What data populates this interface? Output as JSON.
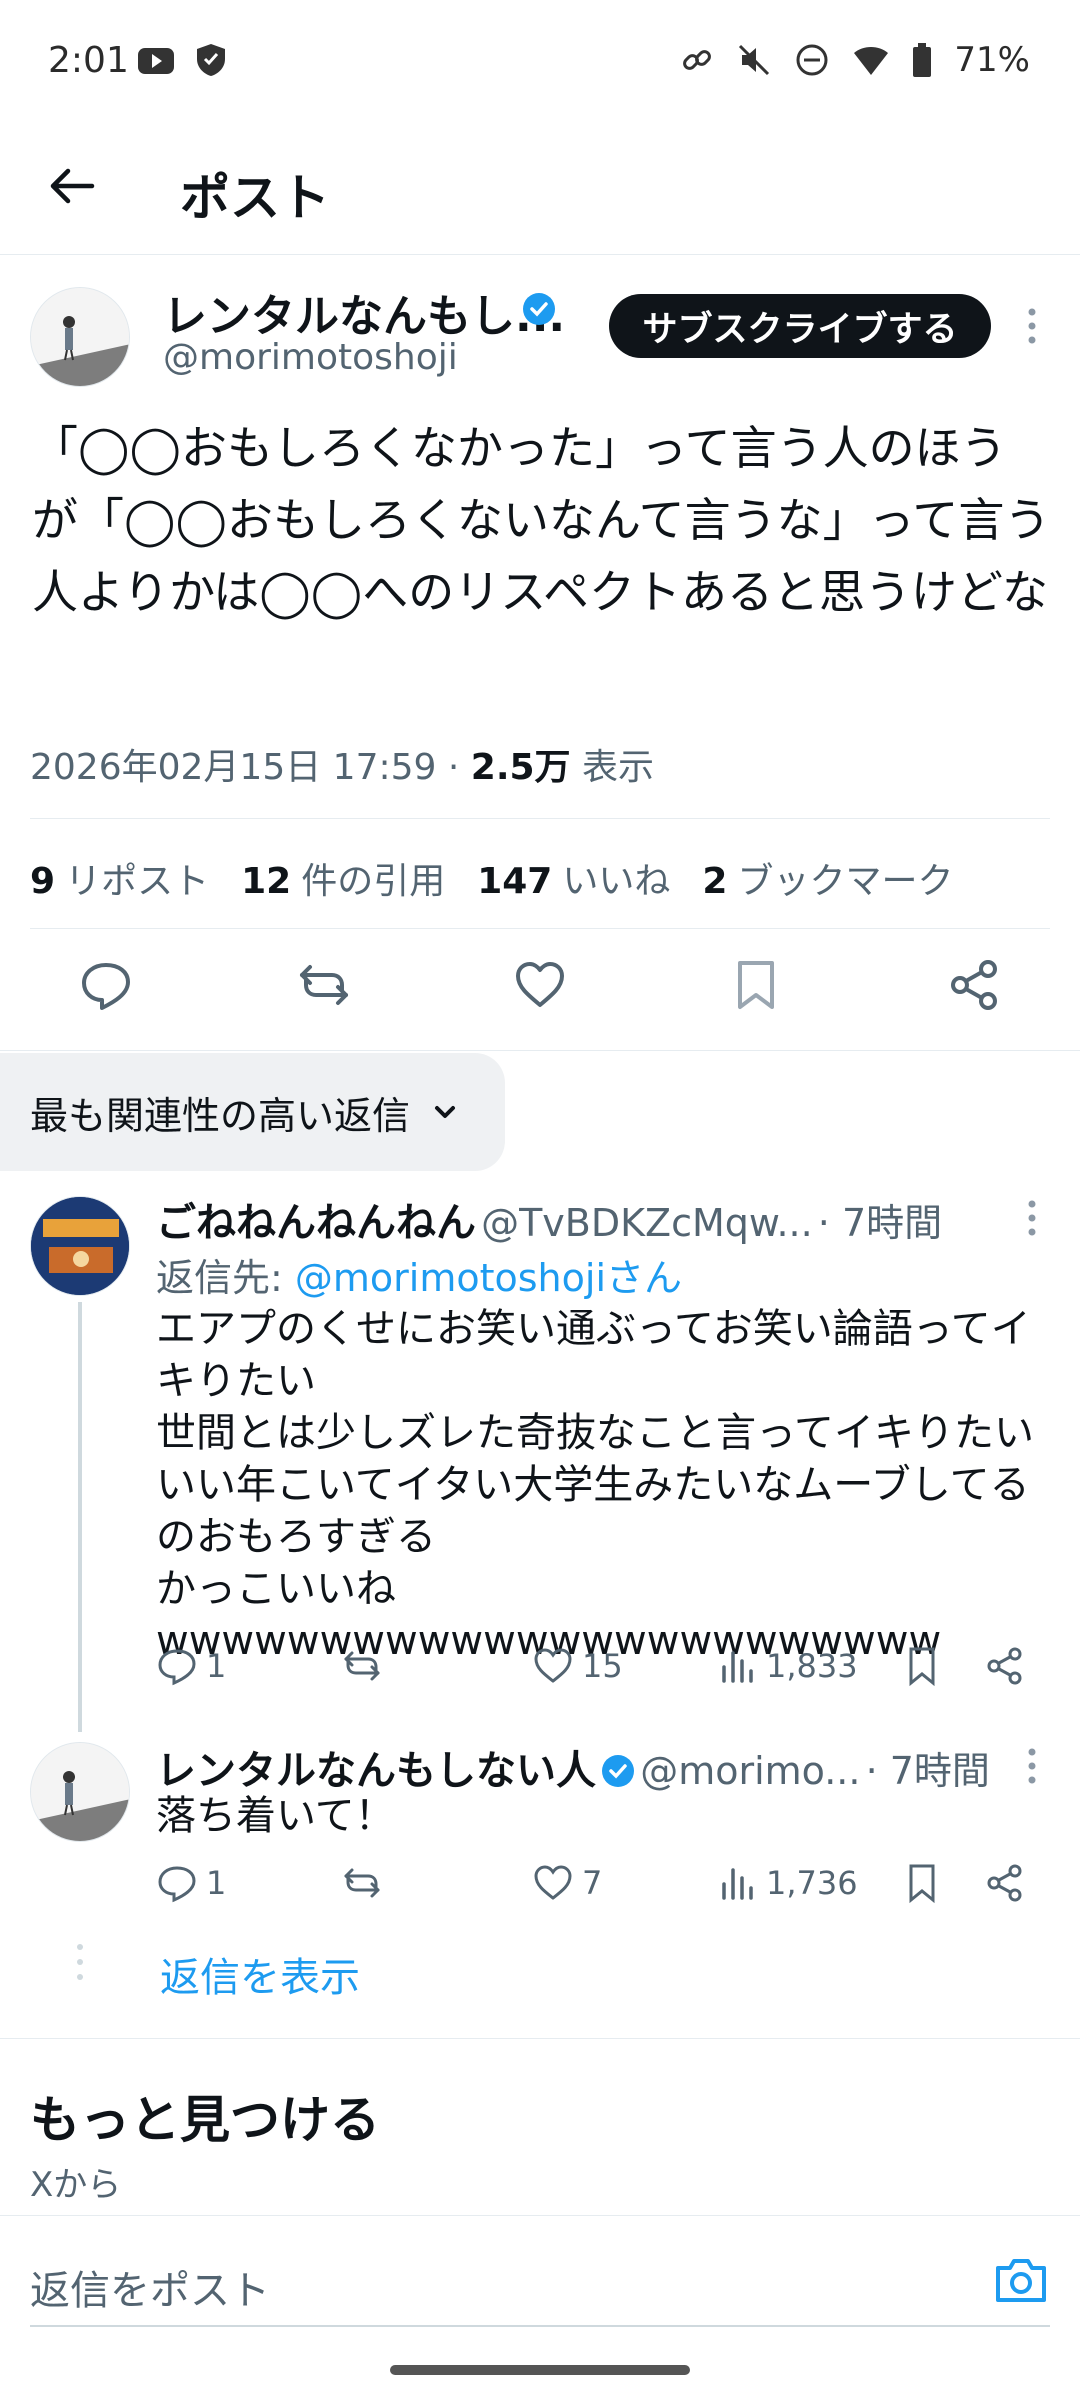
{
  "status_bar": {
    "time": "2:01",
    "battery": "71%",
    "icons_left": [
      "youtube-icon",
      "shield-icon"
    ],
    "icons_right": [
      "link-icon",
      "mute-icon",
      "dnd-icon",
      "wifi-icon",
      "battery-icon"
    ]
  },
  "header": {
    "title": "ポスト"
  },
  "main_post": {
    "author_name": "レンタルなんもし...",
    "handle": "@morimotoshoji",
    "subscribe_label": "サブスクライブする",
    "text": "「◯◯おもしろくなかった」って言う人のほうが「◯◯おもしろくないなんて言うな」って言う人よりかは◯◯へのリスペクトあると思うけどな",
    "date": "2026年02月15日 17:59 · ",
    "views_count": "2.5万",
    "views_label": " 表示",
    "stats": {
      "reposts_count": "9",
      "reposts_label": "リポスト",
      "quotes_count": "12",
      "quotes_label": "件の引用",
      "likes_count": "147",
      "likes_label": "いいね",
      "bookmarks_count": "2",
      "bookmarks_label": "ブックマーク"
    }
  },
  "sort": {
    "label": "最も関連性の高い返信"
  },
  "replies": [
    {
      "name": "ごねねんねんねん",
      "handle": "@TvBDKZcMqw...",
      "time": "· 7時間",
      "reply_to_prefix": "返信先: ",
      "reply_to_user": "@morimotoshojiさん",
      "text": "エアプのくせにお笑い通ぶってお笑い論語ってイキりたい\n世間とは少しズレた奇抜なこと言ってイキりたいいい年こいてイタい大学生みたいなムーブしてるのおもろすぎる\nかっこいいねwwwwwwwwwwwwwwwwwwwwwwww",
      "replies": "1",
      "reposts": "",
      "likes": "15",
      "views": "1,833"
    },
    {
      "name": "レンタルなんもしない人",
      "handle": "@morimo...",
      "time": "· 7時間",
      "text": "落ち着いて！",
      "replies": "1",
      "reposts": "",
      "likes": "7",
      "views": "1,736"
    }
  ],
  "show_replies": "返信を表示",
  "discover": {
    "title": "もっと見つける",
    "subtitle": "Xから"
  },
  "composer": {
    "placeholder": "返信をポスト"
  }
}
